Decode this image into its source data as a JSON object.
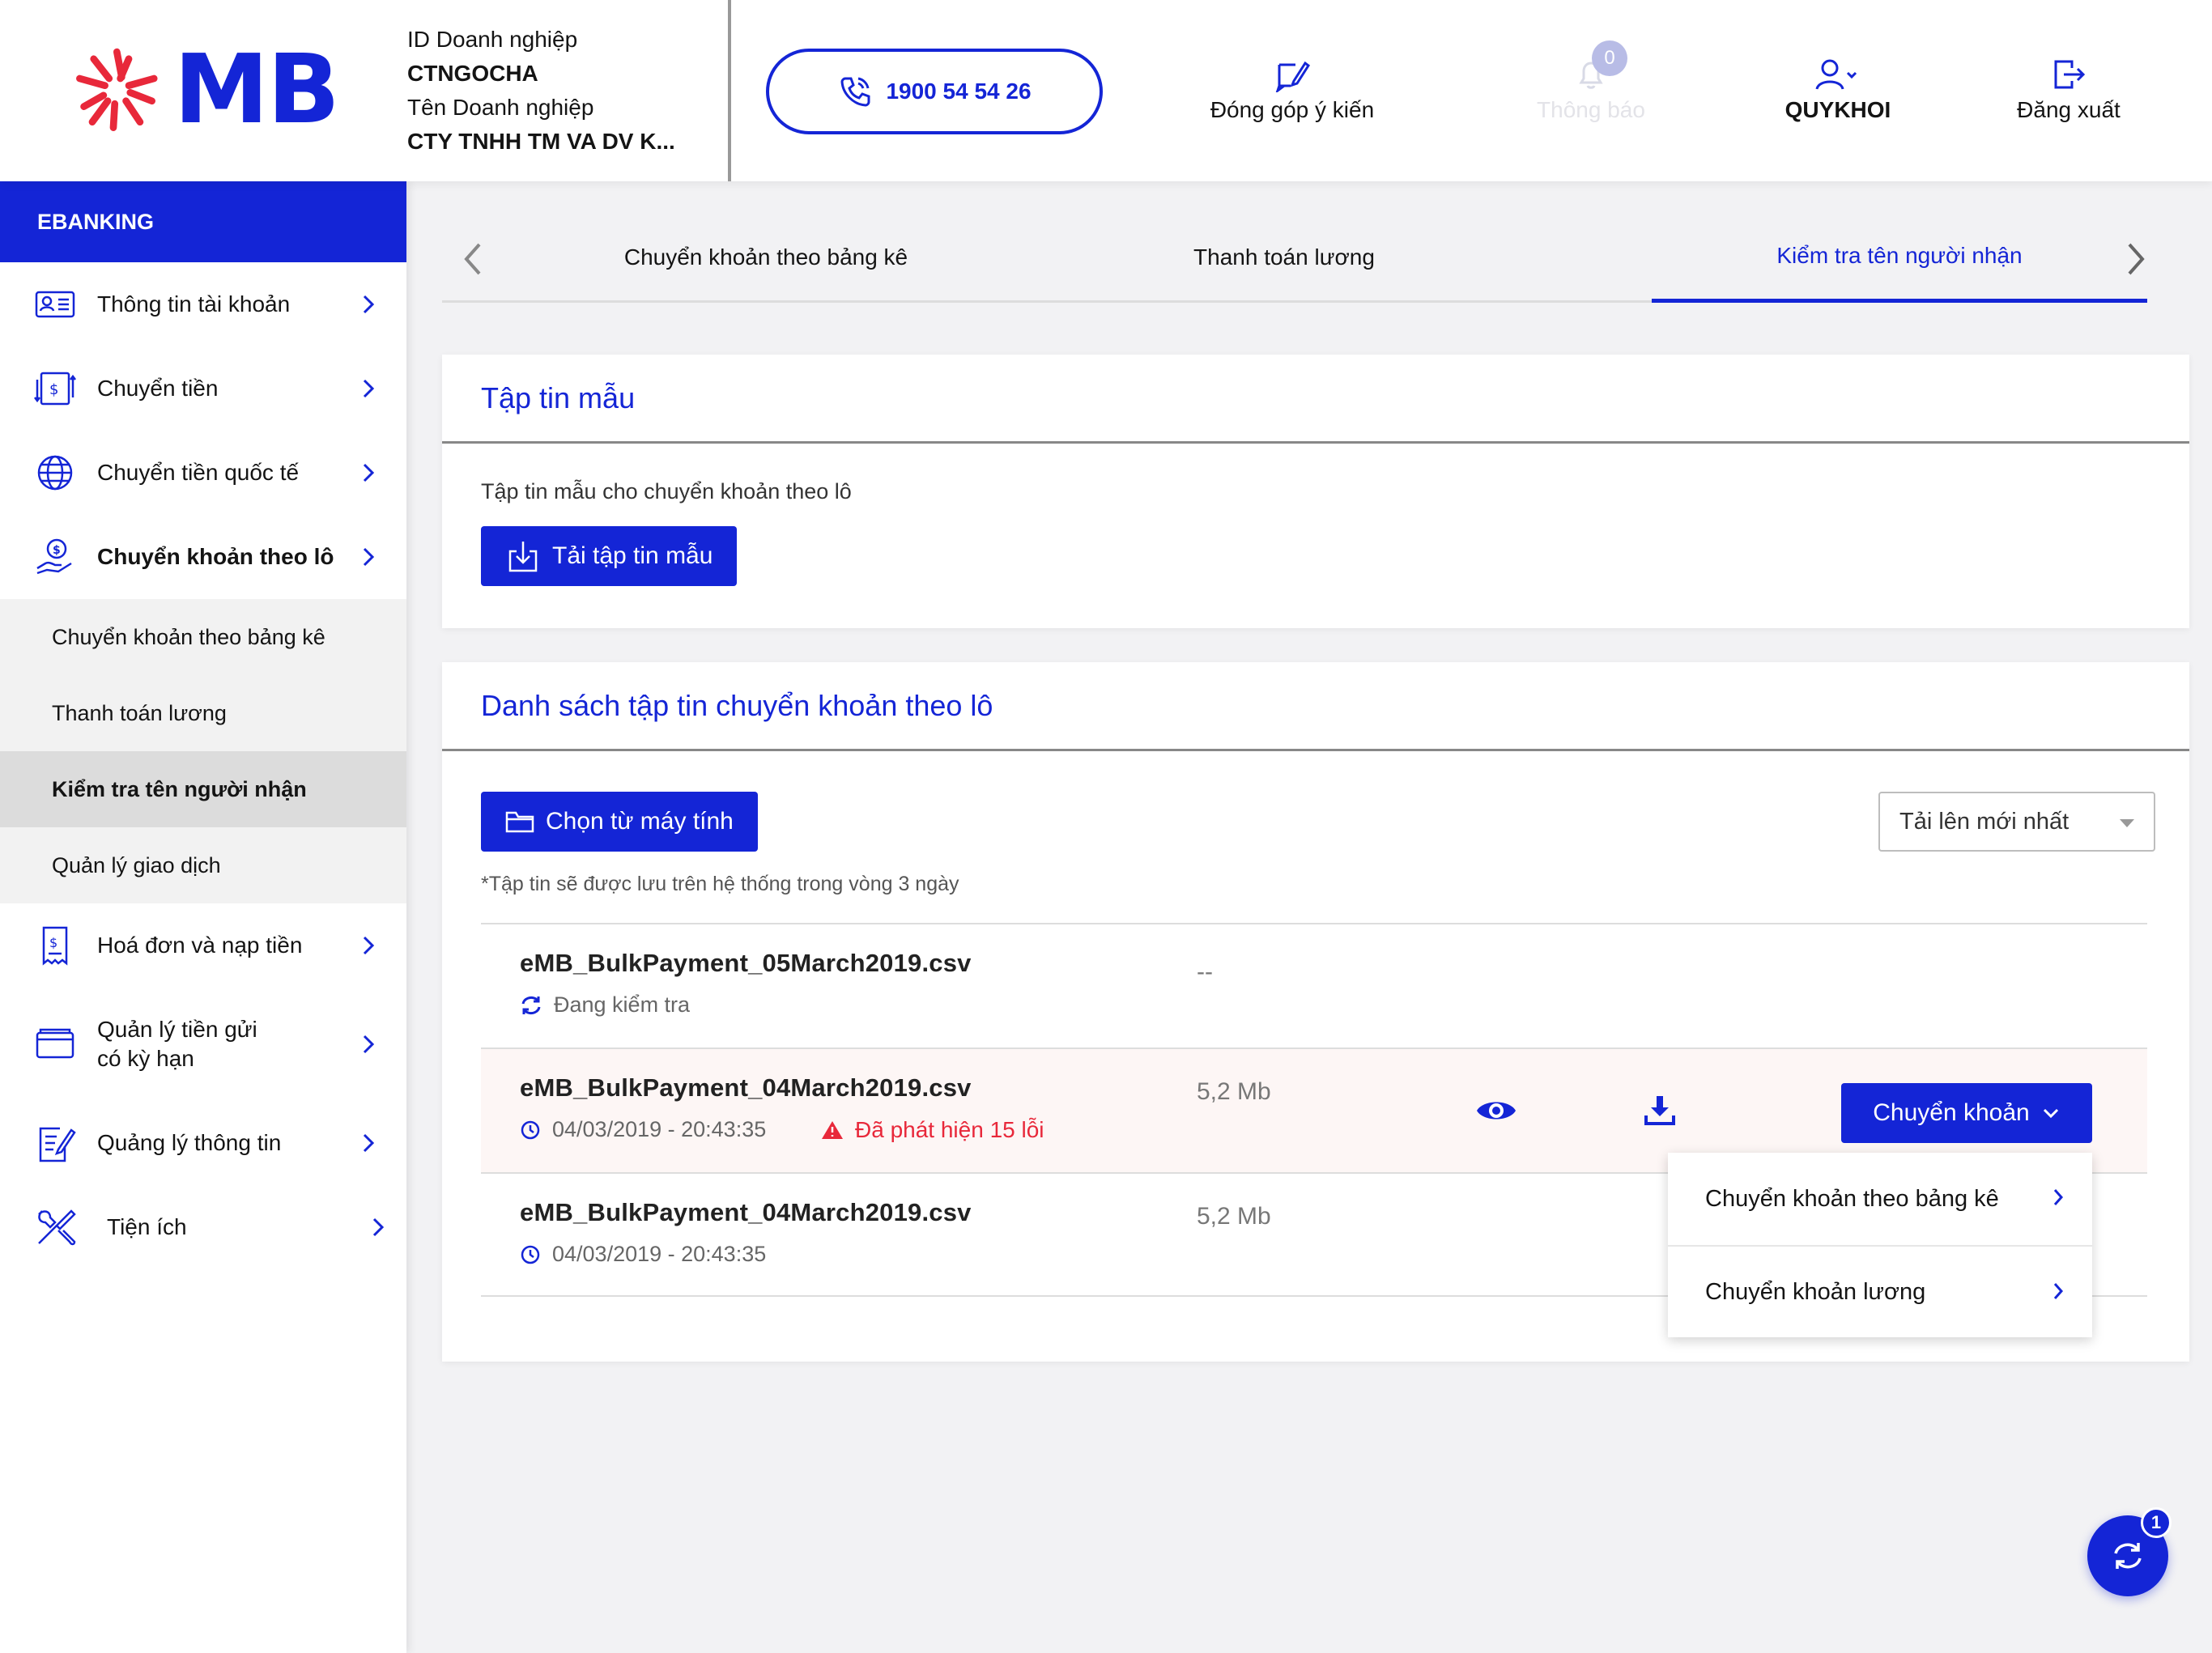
{
  "brand": {
    "logo_text": "MB",
    "primary_color": "#1425d6",
    "logo_star_color": "#e8283a"
  },
  "header": {
    "company_id_label": "ID Doanh nghiệp",
    "company_id_value": "CTNGOCHA",
    "company_name_label": "Tên Doanh nghiệp",
    "company_name_value": "CTY TNHH TM VA DV K...",
    "hotline": "1900 54 54 26",
    "feedback_label": "Đóng góp ý kiến",
    "notification_label": "Thông báo",
    "notification_count": "0",
    "user_name": "QUYKHOI",
    "logout_label": "Đăng xuất"
  },
  "sidebar": {
    "title": "EBANKING",
    "items": [
      {
        "label": "Thông tin tài khoản",
        "icon": "account-card-icon"
      },
      {
        "label": "Chuyển tiền",
        "icon": "money-transfer-icon"
      },
      {
        "label": "Chuyển tiền quốc tế",
        "icon": "globe-icon"
      },
      {
        "label": "Chuyển khoản theo lô",
        "icon": "hand-coin-icon"
      }
    ],
    "sub_items": [
      {
        "label": "Chuyển khoản theo bảng kê"
      },
      {
        "label": "Thanh toán lương"
      },
      {
        "label": "Kiểm tra tên người nhận"
      },
      {
        "label": "Quản lý giao dịch"
      }
    ],
    "items_after": [
      {
        "label": "Hoá đơn và nạp tiền",
        "icon": "receipt-icon"
      },
      {
        "label_line1": "Quản lý tiền gửi",
        "label_line2": "có kỳ hạn",
        "icon": "wallet-icon"
      },
      {
        "label": "Quảng lý thông tin",
        "icon": "document-edit-icon"
      },
      {
        "label": "Tiện ích",
        "icon": "tools-icon"
      }
    ]
  },
  "tabs": [
    {
      "label": "Chuyển khoản theo bảng kê"
    },
    {
      "label": "Thanh toán lương"
    },
    {
      "label": "Kiểm tra tên người nhận",
      "active": true
    }
  ],
  "template_card": {
    "title": "Tập tin mẫu",
    "description": "Tập tin mẫu cho chuyển khoản theo lô",
    "download_button": "Tải tập tin mẫu"
  },
  "files_card": {
    "title": "Danh sách tập tin chuyển khoản theo lô",
    "choose_button": "Chọn từ máy tính",
    "sort_selected": "Tải lên mới nhất",
    "note": "*Tập tin sẽ được lưu trên hệ thống trong vòng 3 ngày",
    "files": [
      {
        "name": "eMB_BulkPayment_05March2019.csv",
        "status": "Đang kiểm tra",
        "size": "--"
      },
      {
        "name": "eMB_BulkPayment_04March2019.csv",
        "datetime": "04/03/2019 - 20:43:35",
        "error": "Đã phát hiện 15 lỗi",
        "size": "5,2 Mb",
        "action": "Chuyển khoản"
      },
      {
        "name": "eMB_BulkPayment_04March2019.csv",
        "datetime": "04/03/2019 - 20:43:35",
        "size": "5,2 Mb"
      }
    ],
    "dropdown": [
      {
        "label": "Chuyển khoản theo bảng kê"
      },
      {
        "label": "Chuyển khoản lương"
      }
    ]
  },
  "fab": {
    "badge": "1",
    "icon": "sync-icon"
  }
}
